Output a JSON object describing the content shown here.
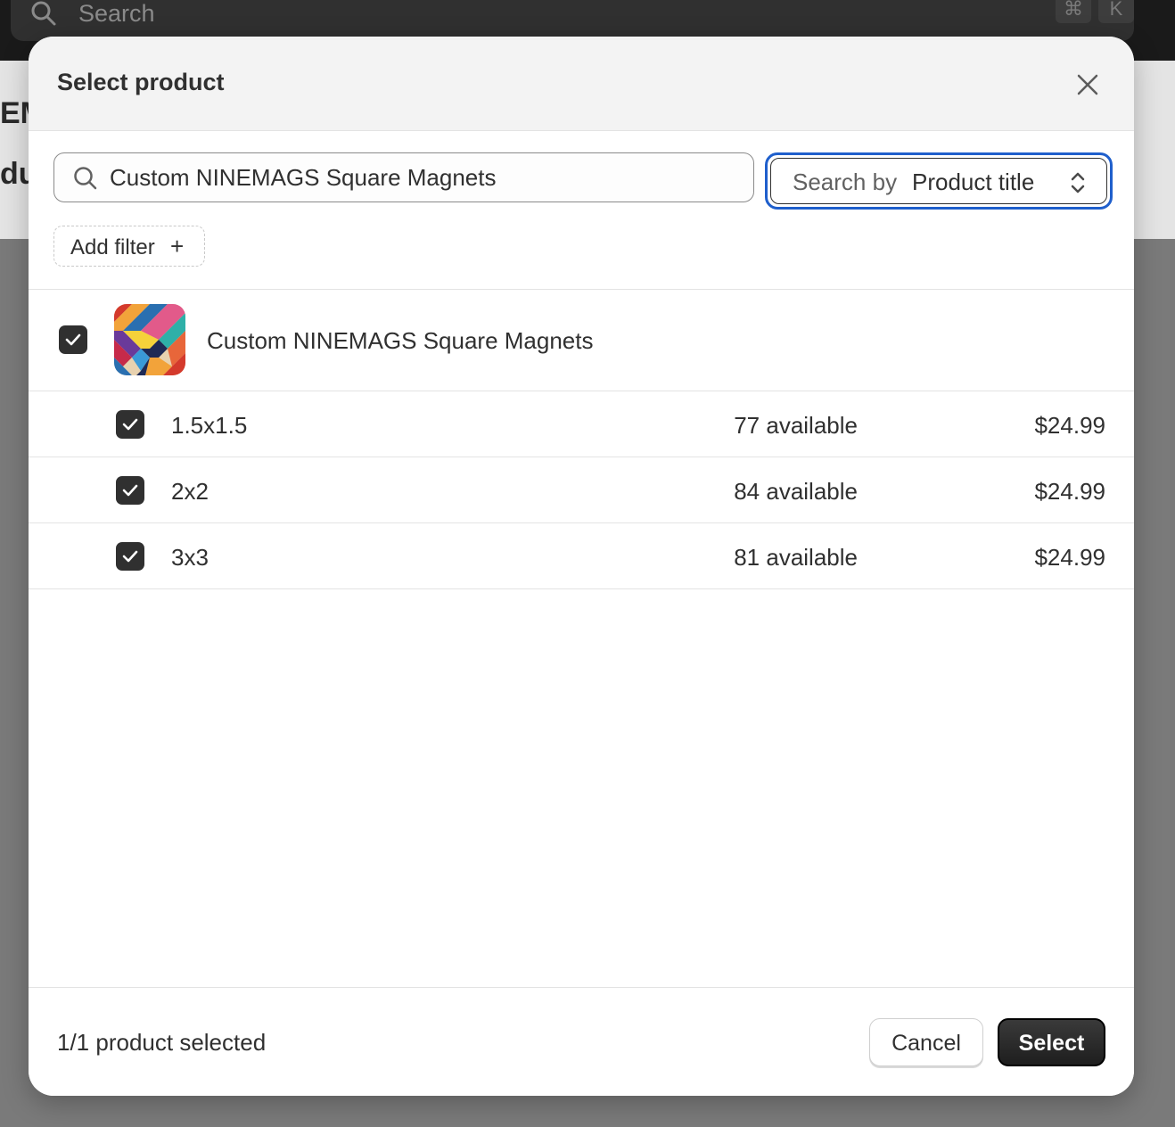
{
  "background": {
    "search_placeholder": "Search",
    "shortcut_keys": [
      "⌘",
      "K"
    ],
    "partial_text_1": "EM",
    "partial_text_2": "du"
  },
  "modal": {
    "title": "Select product",
    "close_icon": "close-icon",
    "search": {
      "value": "Custom NINEMAGS Square Magnets",
      "icon": "search-icon"
    },
    "search_by": {
      "prefix": "Search by",
      "value": "Product title"
    },
    "filter": {
      "label": "Add filter",
      "plus": "+"
    },
    "product": {
      "name": "Custom NINEMAGS Square Magnets",
      "checked": true,
      "variants": [
        {
          "name": "1.5x1.5",
          "available": "77 available",
          "price": "$24.99",
          "checked": true
        },
        {
          "name": "2x2",
          "available": "84 available",
          "price": "$24.99",
          "checked": true
        },
        {
          "name": "3x3",
          "available": "81 available",
          "price": "$24.99",
          "checked": true
        }
      ]
    },
    "footer": {
      "status": "1/1 product selected",
      "cancel_label": "Cancel",
      "select_label": "Select"
    }
  },
  "colors": {
    "focus_ring": "#1f5fcc",
    "checkbox": "#303030",
    "primary_button": "#1e1e1e"
  }
}
